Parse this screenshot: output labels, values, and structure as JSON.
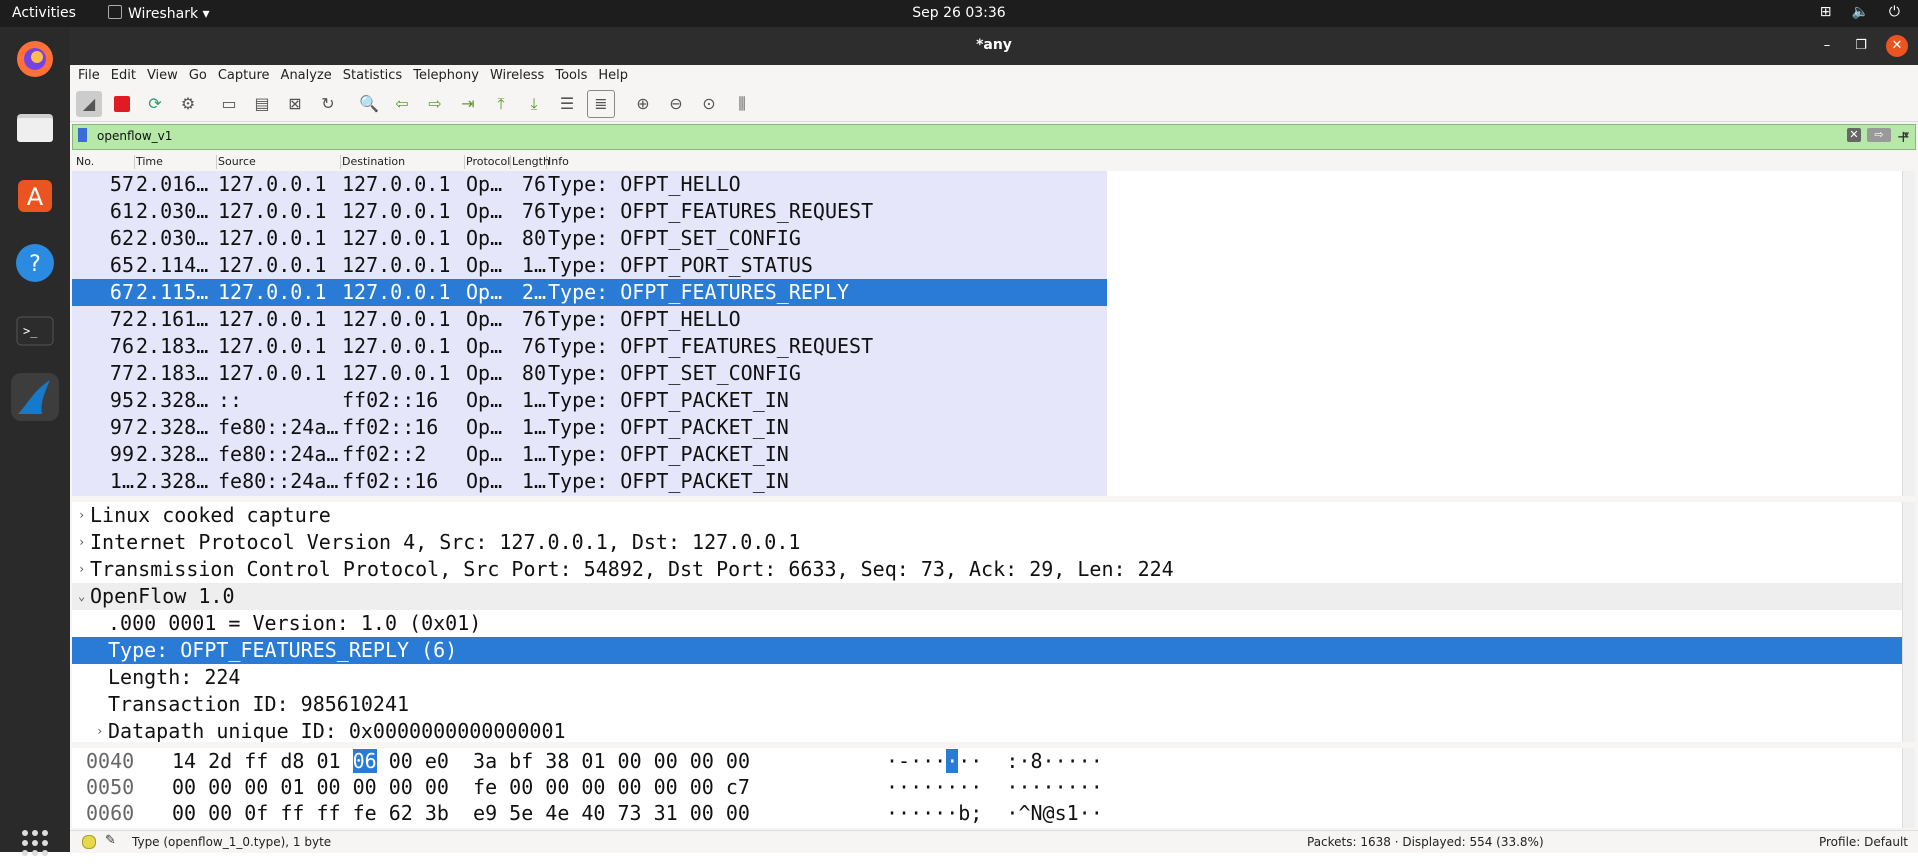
{
  "topbar": {
    "activities": "Activities",
    "app_name": "Wireshark ▾",
    "clock": "Sep 26  03:36",
    "tray": [
      "network-icon",
      "volume-icon",
      "power-icon"
    ]
  },
  "dock": {
    "items": [
      "firefox-icon",
      "files-icon",
      "software-icon",
      "help-icon",
      "terminal-icon",
      "wireshark-icon",
      "app-grid-icon"
    ]
  },
  "window": {
    "title": "*any"
  },
  "menu": [
    "File",
    "Edit",
    "View",
    "Go",
    "Capture",
    "Analyze",
    "Statistics",
    "Telephony",
    "Wireless",
    "Tools",
    "Help"
  ],
  "filter": {
    "value": "openflow_v1"
  },
  "columns": [
    "No.",
    "Time",
    "Source",
    "Destination",
    "Protocol",
    "Length",
    "Info"
  ],
  "packets": [
    {
      "no": "57",
      "time": "2.016…",
      "src": "127.0.0.1",
      "dst": "127.0.0.1",
      "proto": "Op…",
      "len": "76",
      "info": "Type: OFPT_HELLO"
    },
    {
      "no": "61",
      "time": "2.030…",
      "src": "127.0.0.1",
      "dst": "127.0.0.1",
      "proto": "Op…",
      "len": "76",
      "info": "Type: OFPT_FEATURES_REQUEST"
    },
    {
      "no": "62",
      "time": "2.030…",
      "src": "127.0.0.1",
      "dst": "127.0.0.1",
      "proto": "Op…",
      "len": "80",
      "info": "Type: OFPT_SET_CONFIG"
    },
    {
      "no": "65",
      "time": "2.114…",
      "src": "127.0.0.1",
      "dst": "127.0.0.1",
      "proto": "Op…",
      "len": "1…",
      "info": "Type: OFPT_PORT_STATUS"
    },
    {
      "no": "67",
      "time": "2.115…",
      "src": "127.0.0.1",
      "dst": "127.0.0.1",
      "proto": "Op…",
      "len": "2…",
      "info": "Type: OFPT_FEATURES_REPLY"
    },
    {
      "no": "72",
      "time": "2.161…",
      "src": "127.0.0.1",
      "dst": "127.0.0.1",
      "proto": "Op…",
      "len": "76",
      "info": "Type: OFPT_HELLO"
    },
    {
      "no": "76",
      "time": "2.183…",
      "src": "127.0.0.1",
      "dst": "127.0.0.1",
      "proto": "Op…",
      "len": "76",
      "info": "Type: OFPT_FEATURES_REQUEST"
    },
    {
      "no": "77",
      "time": "2.183…",
      "src": "127.0.0.1",
      "dst": "127.0.0.1",
      "proto": "Op…",
      "len": "80",
      "info": "Type: OFPT_SET_CONFIG"
    },
    {
      "no": "95",
      "time": "2.328…",
      "src": "::",
      "dst": "ff02::16",
      "proto": "Op…",
      "len": "1…",
      "info": "Type: OFPT_PACKET_IN"
    },
    {
      "no": "97",
      "time": "2.328…",
      "src": "fe80::24a…",
      "dst": "ff02::16",
      "proto": "Op…",
      "len": "1…",
      "info": "Type: OFPT_PACKET_IN"
    },
    {
      "no": "99",
      "time": "2.328…",
      "src": "fe80::24a…",
      "dst": "ff02::2",
      "proto": "Op…",
      "len": "1…",
      "info": "Type: OFPT_PACKET_IN"
    },
    {
      "no": "1…",
      "time": "2.328…",
      "src": "fe80::24a…",
      "dst": "ff02::16",
      "proto": "Op…",
      "len": "1…",
      "info": "Type: OFPT_PACKET_IN"
    }
  ],
  "details": [
    {
      "text": "Linux cooked capture",
      "arrow": "›",
      "indent": 0
    },
    {
      "text": "Internet Protocol Version 4, Src: 127.0.0.1, Dst: 127.0.0.1",
      "arrow": "›",
      "indent": 0
    },
    {
      "text": "Transmission Control Protocol, Src Port: 54892, Dst Port: 6633, Seq: 73, Ack: 29, Len: 224",
      "arrow": "›",
      "indent": 0
    },
    {
      "text": "OpenFlow 1.0",
      "arrow": "⌄",
      "indent": 0
    },
    {
      "text": ".000 0001 = Version: 1.0 (0x01)",
      "arrow": "",
      "indent": 1
    },
    {
      "text": "Type: OFPT_FEATURES_REPLY (6)",
      "arrow": "",
      "indent": 1
    },
    {
      "text": "Length: 224",
      "arrow": "",
      "indent": 1
    },
    {
      "text": "Transaction ID: 985610241",
      "arrow": "",
      "indent": 1
    },
    {
      "text": "Datapath unique ID: 0x0000000000000001",
      "arrow": "›",
      "indent": 1
    }
  ],
  "hex": [
    {
      "offset": "0040",
      "bytes_a": "14 2d ff d8 01 ",
      "bytes_hl": "06",
      "bytes_b": " 00 e0  3a bf 38 01 00 00 00 00",
      "ascii_a": "·-···",
      "ascii_hl": "·",
      "ascii_b": "··  :·8·····"
    },
    {
      "offset": "0050",
      "bytes_a": "00 00 00 01 00 00 00 00  fe 00 00 00 00 00 00 c7",
      "bytes_hl": "",
      "bytes_b": "",
      "ascii_a": "········  ········",
      "ascii_hl": "",
      "ascii_b": ""
    },
    {
      "offset": "0060",
      "bytes_a": "00 00 0f ff ff fe 62 3b  e9 5e 4e 40 73 31 00 00",
      "bytes_hl": "",
      "bytes_b": "",
      "ascii_a": "······b;  ·^N@s1··",
      "ascii_hl": "",
      "ascii_b": ""
    }
  ],
  "status": {
    "left": "Type (openflow_1_0.type), 1 byte",
    "mid": "Packets: 1638 · Displayed: 554 (33.8%)",
    "right": "Profile: Default"
  },
  "colors": {
    "selection": "#2a7bd6",
    "row_bg": "#e6e6fa",
    "filter_bg": "#b6e8a7"
  }
}
